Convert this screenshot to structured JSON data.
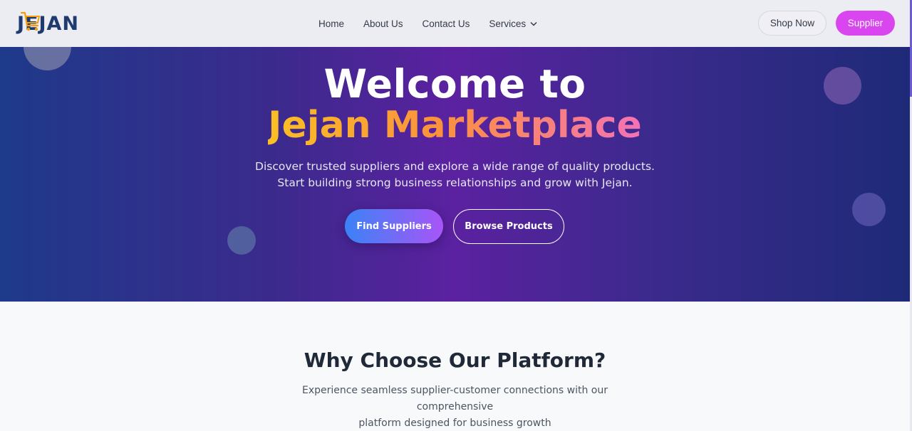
{
  "brand": {
    "logo_text": "JEJAN",
    "cart_color": "#f59e0b",
    "text_color": "#1e3a6e"
  },
  "nav": {
    "items": [
      {
        "label": "Home"
      },
      {
        "label": "About Us"
      },
      {
        "label": "Contact Us"
      },
      {
        "label": "Services",
        "icon": "chevron-down-icon"
      }
    ]
  },
  "header_actions": {
    "shop_label": "Shop Now",
    "supplier_label": "Supplier",
    "supplier_color": "#d946ef"
  },
  "hero": {
    "title_line1": "Welcome to",
    "title_line2": "Jejan Marketplace",
    "subtitle_line1": "Discover trusted suppliers and explore a wide range of quality products.",
    "subtitle_line2": "Start building strong business relationships and grow with Jejan.",
    "primary_button": "Find Suppliers",
    "secondary_button": "Browse Products"
  },
  "why": {
    "title": "Why Choose Our Platform?",
    "subtitle_line1": "Experience seamless supplier-customer connections with our comprehensive",
    "subtitle_line2": "platform designed for business growth"
  }
}
